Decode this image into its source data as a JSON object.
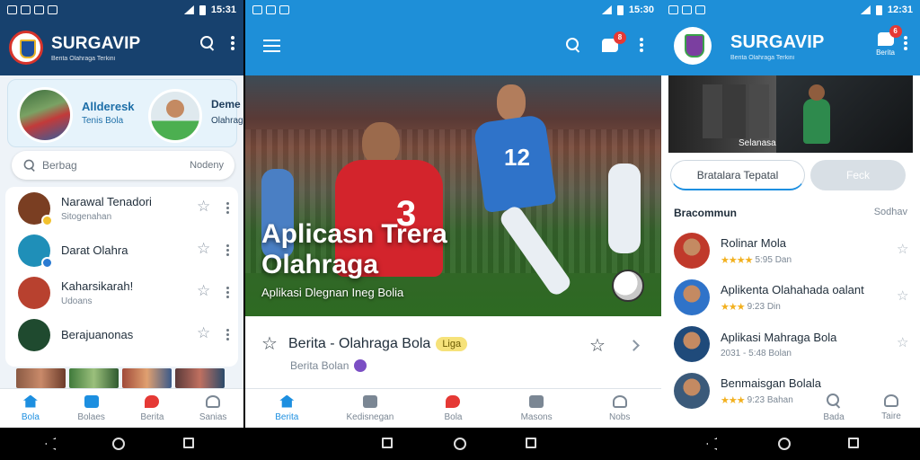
{
  "screen1": {
    "status": {
      "time": "15:31"
    },
    "brand": {
      "name": "SURGAVIP",
      "tagline": "Berita Olahraga Terkini"
    },
    "promo": {
      "title": "Allderesk",
      "subtitle": "Tenis Bola",
      "right_title": "Deme",
      "right_sub": "Olahraga"
    },
    "search": {
      "placeholder": "Berbag",
      "right": "Nodeny"
    },
    "items": [
      {
        "title": "Narawal Tenadori",
        "subtitle": "Sitogenahan",
        "color": "#7a3e22",
        "dot": "#f2c12e"
      },
      {
        "title": "Darat Olahra",
        "subtitle": "",
        "color": "#1f8fb8",
        "dot": "#2a7bd2"
      },
      {
        "title": "Kaharsikarah!",
        "subtitle": "Udoans",
        "color": "#b8412f",
        "dot": "#f3d55a"
      },
      {
        "title": "Berajuanonas",
        "subtitle": "",
        "color": "#1f4a2f",
        "dot": ""
      }
    ],
    "nav": [
      {
        "label": "Bola",
        "icon": "home-icon",
        "active": true
      },
      {
        "label": "Bolaes",
        "icon": "book-icon",
        "active": false
      },
      {
        "label": "Berita",
        "icon": "chat-icon",
        "active": false
      },
      {
        "label": "Sanias",
        "icon": "user-icon",
        "active": false
      }
    ]
  },
  "screen2": {
    "status": {
      "time": "15:30"
    },
    "notif_count": "8",
    "hero": {
      "title_line1": "Aplicasn Trera",
      "title_line2": "Olahraga",
      "subtitle": "Aplikasi Dlegnan Ineg Bolia"
    },
    "card": {
      "title": "Berita - Olahraga Bola",
      "pill": "Liga",
      "subtitle": "Berita Bolan"
    },
    "nav": [
      {
        "label": "Berita",
        "icon": "home-icon",
        "active": true
      },
      {
        "label": "Kedisnegan",
        "icon": "book-icon",
        "active": false
      },
      {
        "label": "Bola",
        "icon": "chat-icon",
        "active": false
      },
      {
        "label": "Masons",
        "icon": "share-icon",
        "active": false
      },
      {
        "label": "Nobs",
        "icon": "user-icon",
        "active": false
      }
    ]
  },
  "screen3": {
    "status": {
      "time": "12:31"
    },
    "brand": {
      "name": "SURGAVIP",
      "tagline": "Berita Olahraga Terkini"
    },
    "notif_count": "6",
    "notif_caption": "Berita",
    "video": {
      "caption": "Selanasa"
    },
    "tabs": [
      {
        "label": "Bratalara Tepatal"
      },
      {
        "label": "Feck"
      }
    ],
    "section": {
      "title": "Bracommun",
      "right": "Sodhav"
    },
    "items": [
      {
        "title": "Rolinar Mola",
        "meta": "5:95 Dan",
        "color": "#c0392b"
      },
      {
        "title": "Aplikenta Olahahada oalant",
        "meta": "9:23 Din",
        "color": "#2f73c9"
      },
      {
        "title": "Aplikasi Mahraga Bola",
        "meta": "2031 - 5:48 Bolan",
        "color": "#1f4a7a"
      },
      {
        "title": "Benmaisgan Bolala",
        "meta": "9:23 Bahan",
        "color": "#3b5a7a"
      }
    ],
    "nav": [
      {
        "label": "Bada",
        "icon": "search-icon"
      },
      {
        "label": "Taire",
        "icon": "user-icon"
      }
    ]
  }
}
